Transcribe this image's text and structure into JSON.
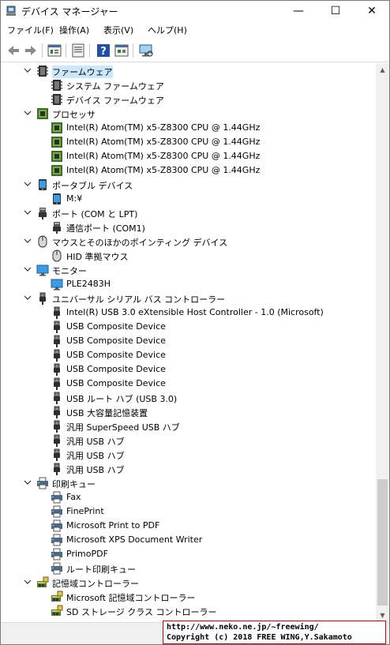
{
  "window": {
    "title": "デバイス マネージャー",
    "minimize": "—",
    "maximize": "☐",
    "close": "✕"
  },
  "menu": [
    "ファイル(F)",
    "操作(A)",
    "表示(V)",
    "ヘルプ(H)"
  ],
  "toolbar": [
    "back-icon",
    "forward-icon",
    "properties-icon",
    "update-driver-icon",
    "help-icon",
    "view-icon",
    "monitor-scan-icon"
  ],
  "tree": [
    {
      "label": "ファームウェア",
      "level": 0,
      "icon": "firmware-icon",
      "selected": true
    },
    {
      "label": "システム ファームウェア",
      "level": 1,
      "icon": "firmware-icon"
    },
    {
      "label": "デバイス ファームウェア",
      "level": 1,
      "icon": "firmware-icon"
    },
    {
      "label": "プロセッサ",
      "level": 0,
      "icon": "processor-icon"
    },
    {
      "label": "Intel(R) Atom(TM) x5-Z8300  CPU @ 1.44GHz",
      "level": 1,
      "icon": "processor-icon"
    },
    {
      "label": "Intel(R) Atom(TM) x5-Z8300  CPU @ 1.44GHz",
      "level": 1,
      "icon": "processor-icon"
    },
    {
      "label": "Intel(R) Atom(TM) x5-Z8300  CPU @ 1.44GHz",
      "level": 1,
      "icon": "processor-icon"
    },
    {
      "label": "Intel(R) Atom(TM) x5-Z8300  CPU @ 1.44GHz",
      "level": 1,
      "icon": "processor-icon"
    },
    {
      "label": "ポータブル デバイス",
      "level": 0,
      "icon": "portable-device-icon"
    },
    {
      "label": "M:¥",
      "level": 1,
      "icon": "portable-device-icon"
    },
    {
      "label": "ポート (COM と LPT)",
      "level": 0,
      "icon": "port-icon"
    },
    {
      "label": "通信ポート (COM1)",
      "level": 1,
      "icon": "port-icon"
    },
    {
      "label": "マウスとそのほかのポインティング デバイス",
      "level": 0,
      "icon": "mouse-icon"
    },
    {
      "label": "HID 準拠マウス",
      "level": 1,
      "icon": "mouse-icon"
    },
    {
      "label": "モニター",
      "level": 0,
      "icon": "monitor-icon"
    },
    {
      "label": "PLE2483H",
      "level": 1,
      "icon": "monitor-icon"
    },
    {
      "label": "ユニバーサル シリアル バス コントローラー",
      "level": 0,
      "icon": "usb-icon"
    },
    {
      "label": "Intel(R) USB 3.0 eXtensible Host Controller - 1.0 (Microsoft)",
      "level": 1,
      "icon": "usb-icon"
    },
    {
      "label": "USB Composite Device",
      "level": 1,
      "icon": "usb-icon"
    },
    {
      "label": "USB Composite Device",
      "level": 1,
      "icon": "usb-icon"
    },
    {
      "label": "USB Composite Device",
      "level": 1,
      "icon": "usb-icon"
    },
    {
      "label": "USB Composite Device",
      "level": 1,
      "icon": "usb-icon"
    },
    {
      "label": "USB Composite Device",
      "level": 1,
      "icon": "usb-icon"
    },
    {
      "label": "USB ルート ハブ (USB 3.0)",
      "level": 1,
      "icon": "usb-icon"
    },
    {
      "label": "USB 大容量記憶装置",
      "level": 1,
      "icon": "usb-icon"
    },
    {
      "label": "汎用 SuperSpeed USB ハブ",
      "level": 1,
      "icon": "usb-icon"
    },
    {
      "label": "汎用 USB ハブ",
      "level": 1,
      "icon": "usb-icon"
    },
    {
      "label": "汎用 USB ハブ",
      "level": 1,
      "icon": "usb-icon"
    },
    {
      "label": "汎用 USB ハブ",
      "level": 1,
      "icon": "usb-icon"
    },
    {
      "label": "印刷キュー",
      "level": 0,
      "icon": "printer-icon"
    },
    {
      "label": "Fax",
      "level": 1,
      "icon": "printer-icon"
    },
    {
      "label": "FinePrint",
      "level": 1,
      "icon": "printer-icon"
    },
    {
      "label": "Microsoft Print to PDF",
      "level": 1,
      "icon": "printer-icon"
    },
    {
      "label": "Microsoft XPS Document Writer",
      "level": 1,
      "icon": "printer-icon"
    },
    {
      "label": "PrimoPDF",
      "level": 1,
      "icon": "printer-icon"
    },
    {
      "label": "ルート印刷キュー",
      "level": 1,
      "icon": "printer-icon"
    },
    {
      "label": "記憶域コントローラー",
      "level": 0,
      "icon": "storage-controller-icon"
    },
    {
      "label": "Microsoft 記憶域コントローラー",
      "level": 1,
      "icon": "storage-controller-icon"
    },
    {
      "label": "SD ストレージ クラス コントローラー",
      "level": 1,
      "icon": "storage-controller-icon"
    }
  ],
  "watermark": {
    "line1": "http://www.neko.ne.jp/~freewing/",
    "line2": "Copyright (c) 2018 FREE WING,Y.Sakamoto"
  },
  "colors": {
    "selection": "#cce8ff",
    "accent": "#0078d7"
  }
}
